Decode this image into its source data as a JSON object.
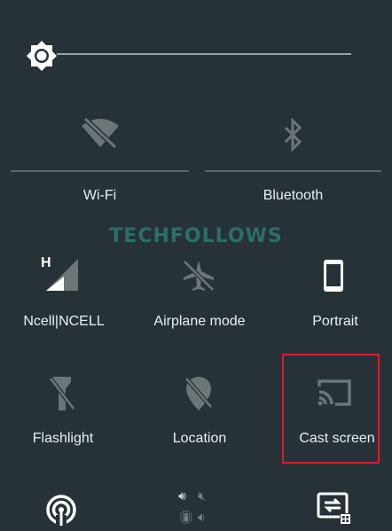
{
  "brightness": {
    "level_fraction": 1.0
  },
  "watermark": "TECHFOLLOWS",
  "tiles": {
    "wifi": {
      "label": "Wi-Fi",
      "icon": "wifi-off-icon",
      "state": "off"
    },
    "bluetooth": {
      "label": "Bluetooth",
      "icon": "bluetooth-icon",
      "state": "off"
    },
    "cellular": {
      "label": "Ncell|NCELL",
      "icon": "cell-signal-icon",
      "network_type": "H"
    },
    "airplane": {
      "label": "Airplane mode",
      "icon": "airplane-icon",
      "state": "off"
    },
    "rotation": {
      "label": "Portrait",
      "icon": "portrait-phone-icon"
    },
    "flashlight": {
      "label": "Flashlight",
      "icon": "flashlight-off-icon",
      "state": "off"
    },
    "location": {
      "label": "Location",
      "icon": "location-off-icon",
      "state": "off"
    },
    "cast": {
      "label": "Cast screen",
      "icon": "cast-icon"
    }
  },
  "bottom_row": [
    {
      "icon": "hotspot-icon"
    },
    {
      "icon": "sound-mode-icons"
    },
    {
      "icon": "screen-share-icon"
    }
  ],
  "colors": {
    "background": "#263238",
    "highlight": "#d61f2c",
    "watermark": "#2b6f67"
  }
}
